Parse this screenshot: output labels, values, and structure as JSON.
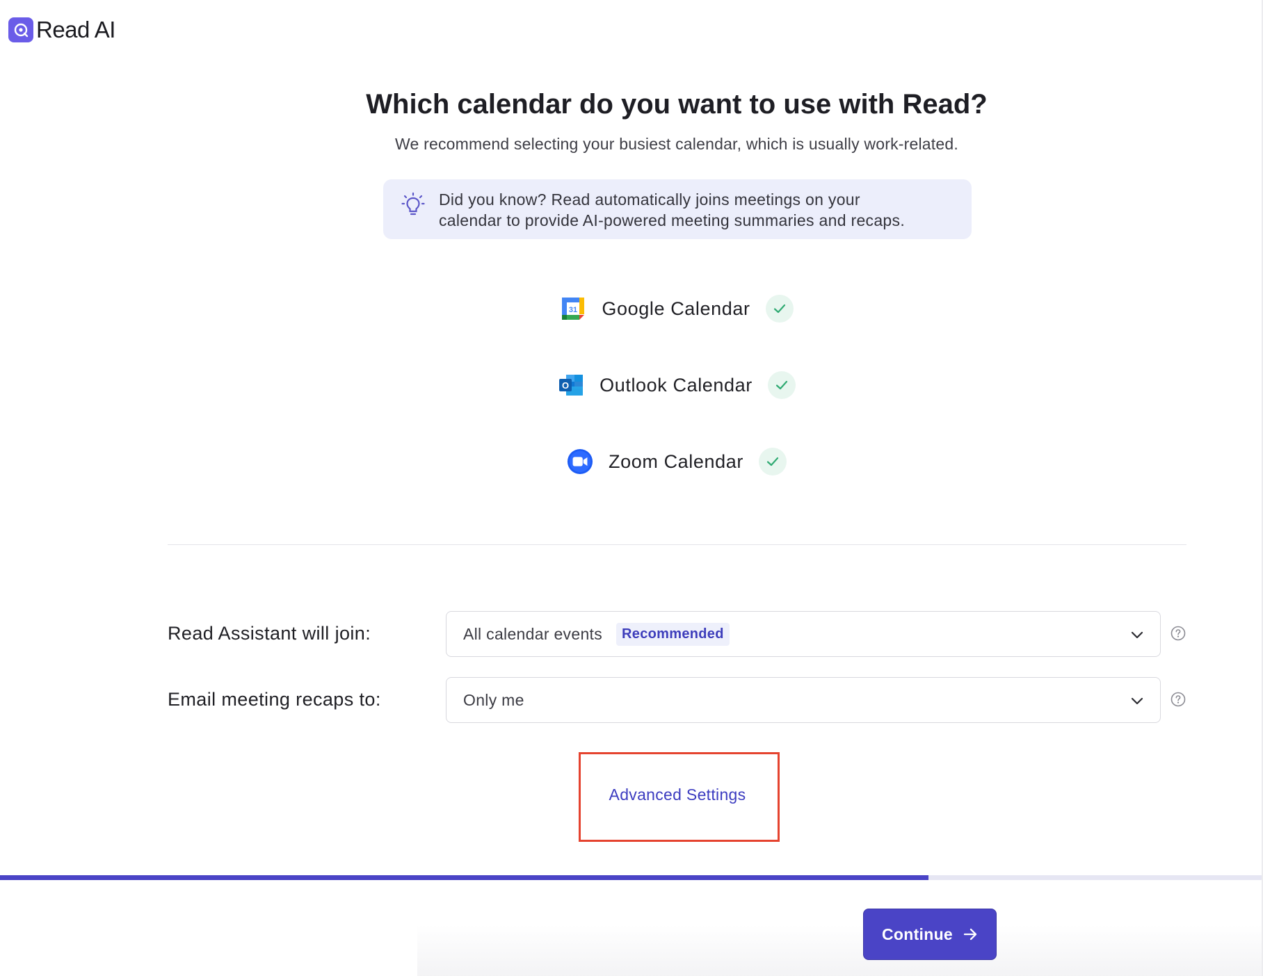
{
  "brand": {
    "name": "Read AI",
    "accent_color": "#4a44c6"
  },
  "header": {
    "title": "Which calendar do you want to use with Read?",
    "subtitle": "We recommend selecting your busiest calendar, which is usually work-related."
  },
  "tip": {
    "icon": "lightbulb-icon",
    "line1": "Did you know? Read automatically joins meetings on your",
    "line2": "calendar to provide AI-powered meeting summaries and recaps."
  },
  "calendars": [
    {
      "label": "Google Calendar",
      "icon": "google-calendar-icon",
      "icon_text": "31",
      "connected": true
    },
    {
      "label": "Outlook Calendar",
      "icon": "outlook-calendar-icon",
      "icon_text": "O",
      "connected": true
    },
    {
      "label": "Zoom Calendar",
      "icon": "zoom-calendar-icon",
      "connected": true
    }
  ],
  "settings": {
    "assistant_join": {
      "label": "Read Assistant will join:",
      "value": "All calendar events",
      "badge": "Recommended"
    },
    "email_recaps": {
      "label": "Email meeting recaps to:",
      "value": "Only me"
    }
  },
  "advanced": {
    "label": "Advanced Settings"
  },
  "progress": {
    "percent": 73.5
  },
  "footer": {
    "continue_label": "Continue"
  }
}
